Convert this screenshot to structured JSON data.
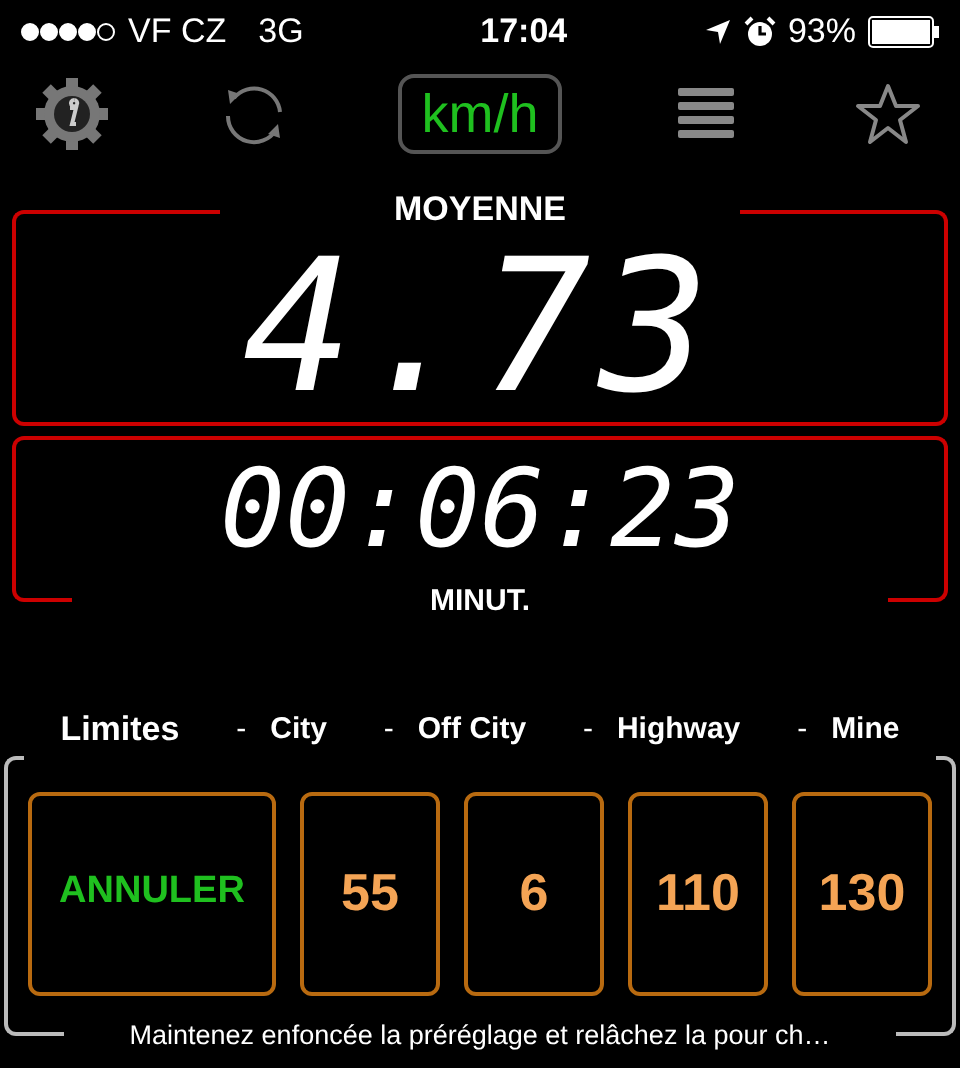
{
  "status_bar": {
    "carrier": "VF CZ",
    "network": "3G",
    "time": "17:04",
    "battery": "93%"
  },
  "toolbar": {
    "unit": "km/h"
  },
  "average": {
    "label": "MOYENNE",
    "value": "4.73"
  },
  "duration": {
    "value": "00:06:23",
    "label": "MINUT."
  },
  "limits": {
    "title": "Limites",
    "headers": [
      "City",
      "Off City",
      "Highway",
      "Mine"
    ],
    "separators": [
      "-",
      "-",
      "-",
      "-"
    ],
    "buttons": [
      {
        "kind": "action",
        "label": "ANNULER"
      },
      {
        "kind": "preset",
        "label": "55"
      },
      {
        "kind": "preset",
        "label": "6"
      },
      {
        "kind": "preset",
        "label": "110"
      },
      {
        "kind": "preset",
        "label": "130"
      }
    ],
    "hint": "Maintenez enfoncée la préréglage et relâchez la pour ch…"
  }
}
